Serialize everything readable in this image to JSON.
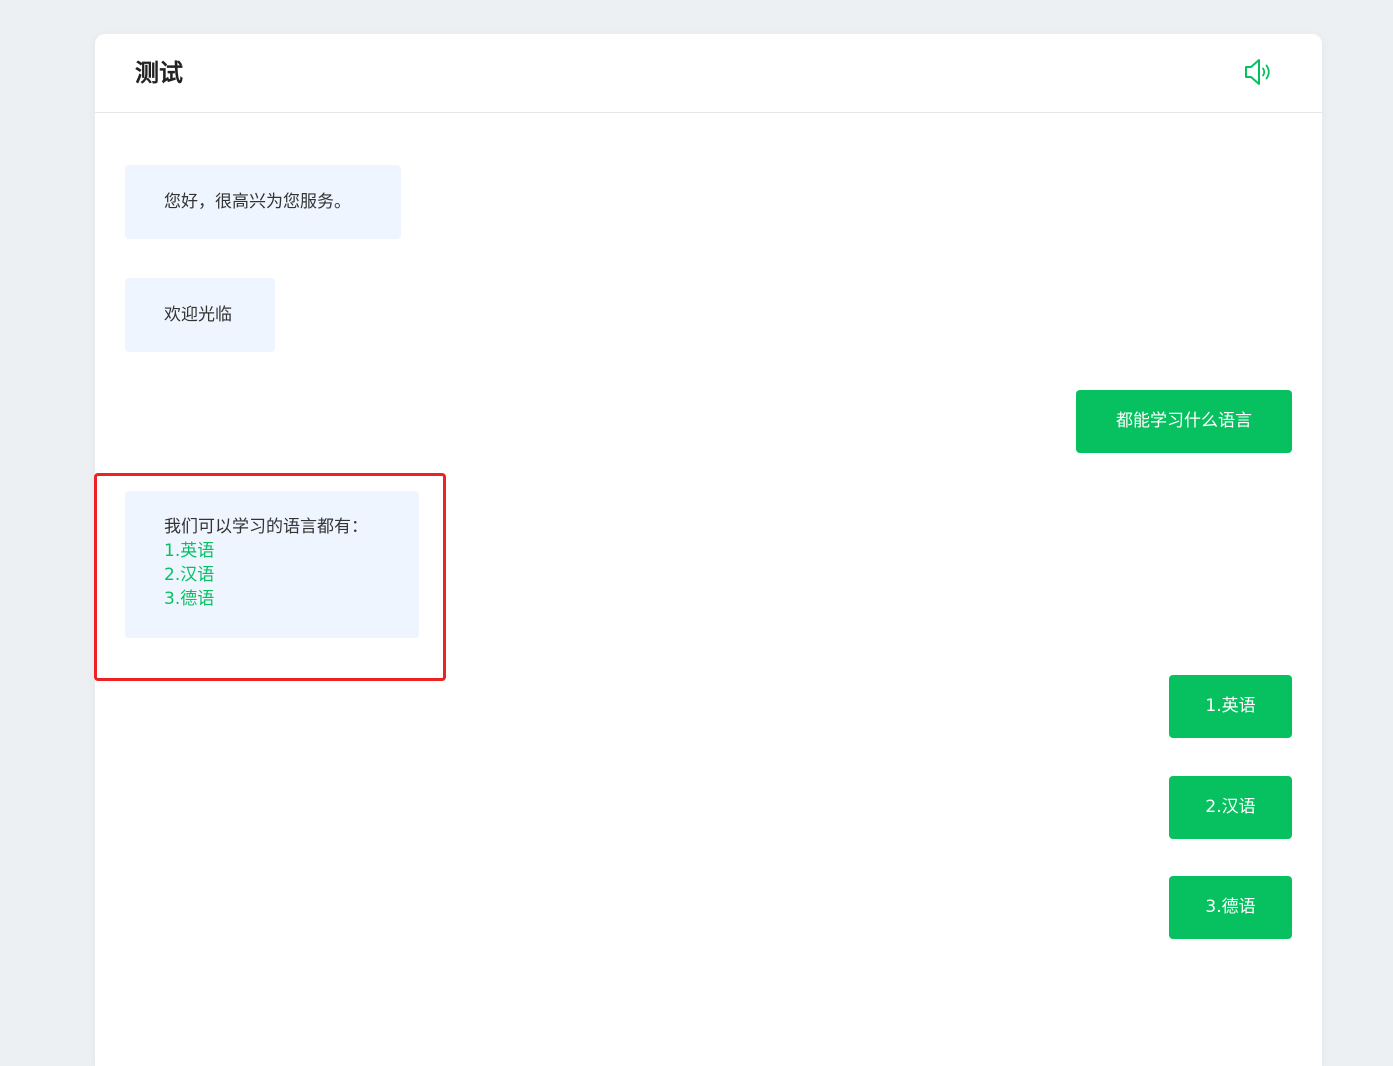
{
  "header": {
    "title": "测试",
    "sound_icon": "speaker-icon",
    "accent_color": "#07c160"
  },
  "messages": {
    "bot_greeting": "您好，很高兴为您服务。",
    "bot_welcome": "欢迎光临",
    "user_question": "都能学习什么语言",
    "bot_answer_intro": "我们可以学习的语言都有：",
    "bot_answer_options": [
      "1.英语",
      "2.汉语",
      "3.德语"
    ],
    "user_replies": [
      "1.英语",
      "2.汉语",
      "3.德语"
    ]
  },
  "colors": {
    "bot_bubble": "#eef5ff",
    "user_bubble": "#07c160",
    "highlight_border": "#ee2222"
  }
}
